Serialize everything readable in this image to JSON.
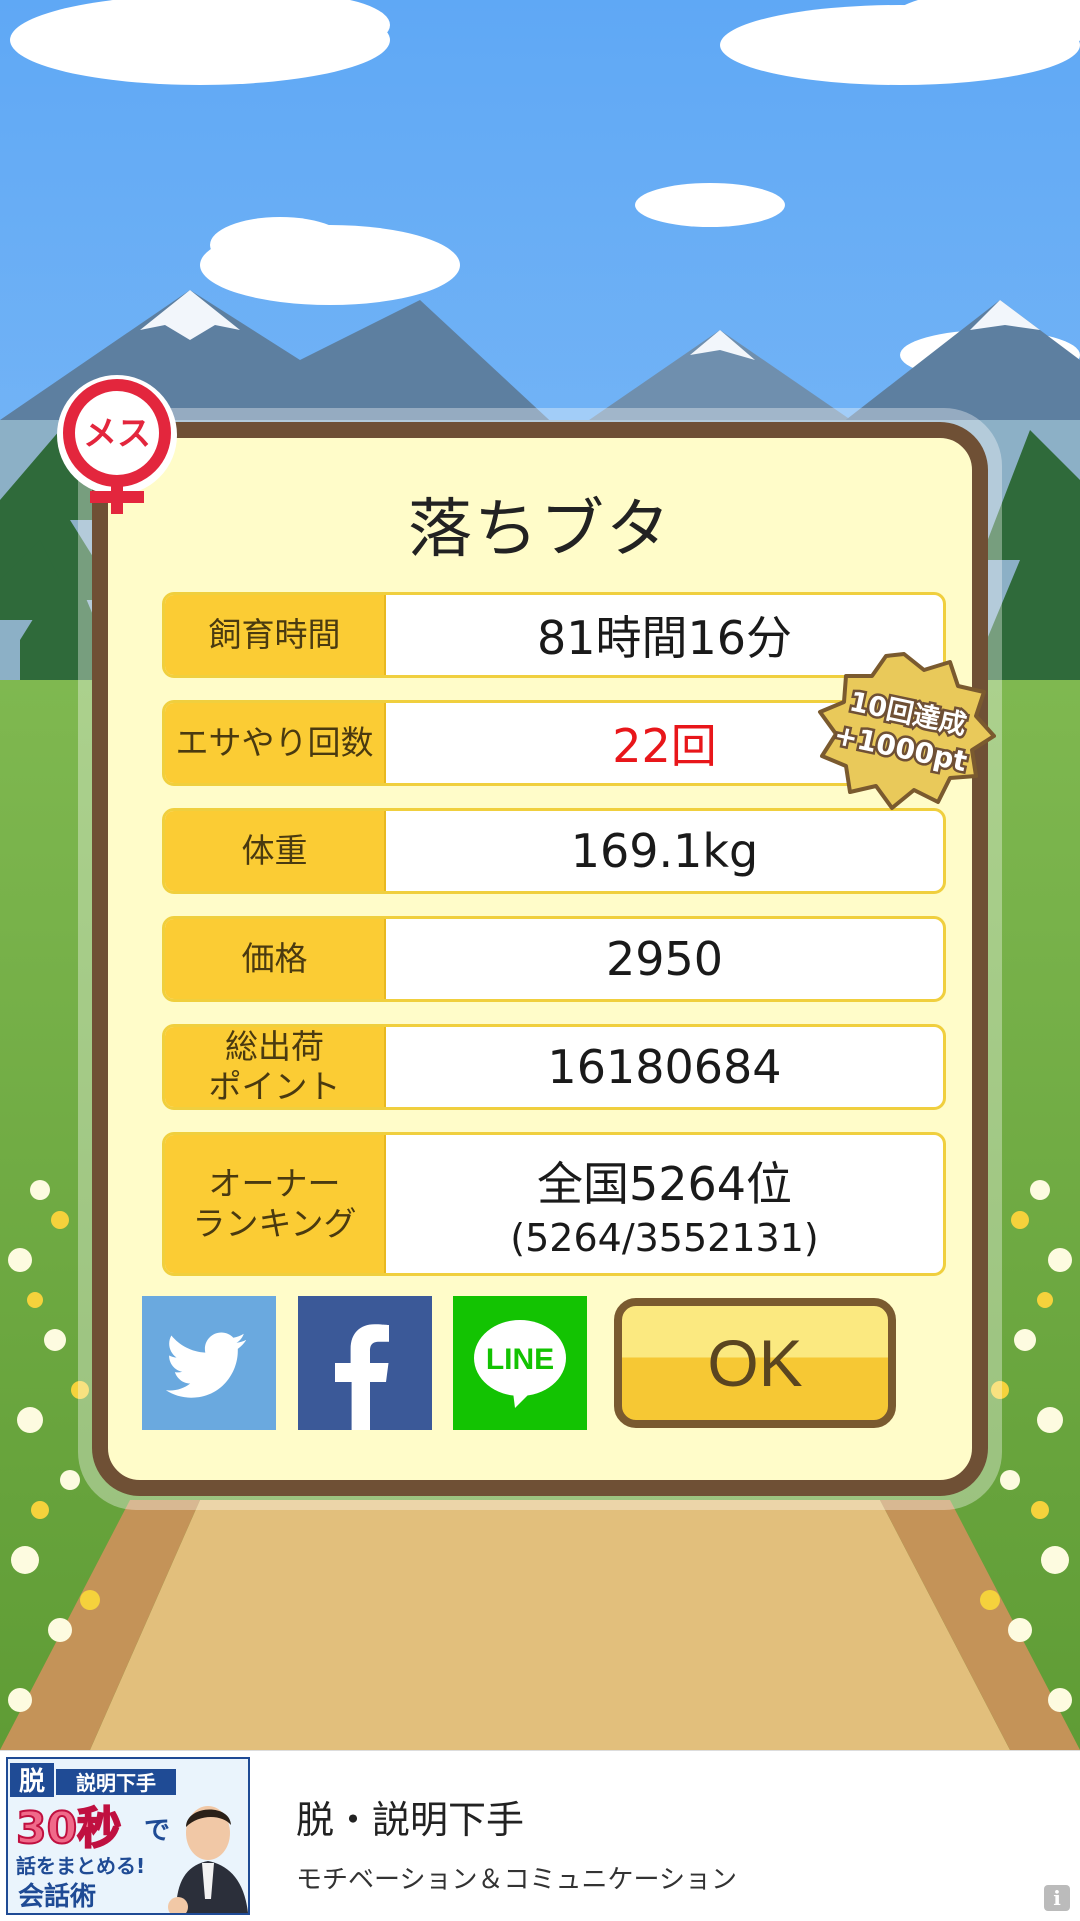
{
  "result": {
    "title": "落ちブタ",
    "gender_label": "メス",
    "stats": [
      {
        "label": "飼育時間",
        "value": "81時間16分"
      },
      {
        "label": "エサやり回数",
        "value": "22回"
      },
      {
        "label": "体重",
        "value": "169.1kg"
      },
      {
        "label": "価格",
        "value": "2950"
      },
      {
        "label": "総出荷\nポイント",
        "value": "16180684"
      },
      {
        "label": "オーナー\nランキング",
        "value": "全国5264位",
        "sub": "(5264/3552131)"
      }
    ],
    "badge": {
      "line1": "10回達成",
      "line2": "+1000pt"
    },
    "share": {
      "twitter": "twitter-share",
      "facebook": "facebook-share",
      "line": "LINE"
    },
    "ok_label": "OK"
  },
  "ad": {
    "thumb": {
      "tag1": "脱",
      "tag2": "説明下手",
      "big": "30秒",
      "with": "で",
      "line2": "話をまとめる!",
      "line3": "会話術"
    },
    "title": "脱・説明下手",
    "subtitle": "モチベーション＆コミュニケーション",
    "info": "i"
  },
  "colors": {
    "sky": "#6fb0f5",
    "frame": "#6f5035",
    "card": "#fffcc9",
    "label_bg": "#fbcc34",
    "highlight_value": "#e8161a",
    "twitter": "#6aa9df",
    "facebook": "#3b5998",
    "line": "#13c302"
  }
}
